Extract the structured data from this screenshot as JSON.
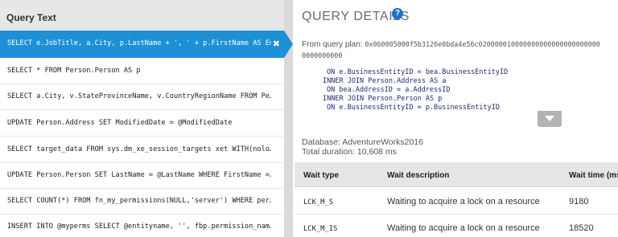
{
  "queries": {
    "header": "Query Text",
    "rows": [
      "SELECT e.JobTitle, a.City, p.LastName + ', ' + p.FirstName AS Em",
      "SELECT * FROM Person.Person AS p",
      "SELECT a.City, v.StateProvinceName, v.CountryRegionName FROM Pe…",
      "UPDATE Person.Address SET ModifiedDate = @ModifiedDate",
      "SELECT target_data FROM sys.dm_xe_session_targets xet WITH(nolo…",
      "UPDATE Person.Person SET LastName = @LastName WHERE FirstName =…",
      "SELECT COUNT(*) FROM fn_my_permissions(NULL,'server') WHERE per…",
      "INSERT INTO @myperms SELECT @entityname, '', fbp.permission_nam…"
    ],
    "close_glyph": "✖"
  },
  "details": {
    "title": "QUERY DETAILS",
    "help_glyph": "?",
    "plan_prefix": "From query plan:",
    "plan_hash": "0x060005000f5b3126e0bda4e56c020000010000000000000000000000",
    "plan_hash_cont": "0000000000",
    "code": [
      "ON e.BusinessEntityID = bea.BusinessEntityID",
      "INNER JOIN Person.Address AS a",
      "ON bea.AddressID = a.AddressID",
      "INNER JOIN Person.Person AS p",
      "ON e.BusinessEntityID = p.BusinessEntityID"
    ],
    "database": "Database: AdventureWorks2016",
    "duration": "Total duration: 10,608 ms"
  },
  "waits": {
    "headers": [
      "Wait type",
      "Wait description",
      "Wait time (ms)"
    ],
    "rows": [
      {
        "type": "LCK_M_S",
        "desc": "Waiting to acquire a lock on a resource",
        "time": "9180"
      },
      {
        "type": "LCK_M_IS",
        "desc": "Waiting to acquire a lock on a resource",
        "time": "18520"
      }
    ]
  },
  "colors": {
    "selected_row": "#1e90d6",
    "help_icon": "#1a73c9",
    "code_text": "#1f2a7a"
  }
}
